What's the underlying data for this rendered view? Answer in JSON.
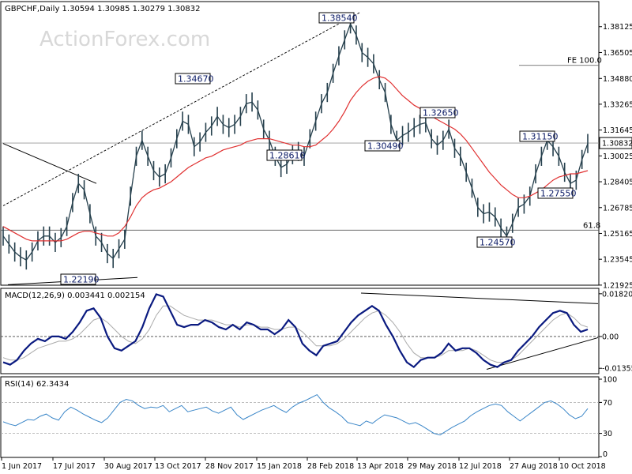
{
  "header": {
    "title": "GBPCHF,Daily  1.30594 1.30985 1.30279 1.30832",
    "watermark": "ActionForex.com"
  },
  "colors": {
    "price": "#26404d",
    "ma": "#e03030",
    "macd": "#0a1a80",
    "signal": "#aaaaaa",
    "rsi": "#3a86c8"
  },
  "chart_data": [
    {
      "type": "line",
      "panel": "price",
      "title": "GBPCHF,Daily  1.30594 1.30985 1.30279 1.30832",
      "ylim": [
        1.2192,
        1.394
      ],
      "y_ticks": [
        "1.38125",
        "1.36505",
        "1.34880",
        "1.33265",
        "1.31645",
        "1.30025",
        "1.28405",
        "1.26785",
        "1.25165",
        "1.23545",
        "1.21925"
      ],
      "current_price": "1.30832",
      "x_ticks": [
        "1 Jun 2017",
        "17 Jul 2017",
        "30 Aug 2017",
        "13 Oct 2017",
        "28 Nov 2017",
        "15 Jan 2018",
        "28 Feb 2018",
        "13 Apr 2018",
        "29 May 2018",
        "12 Jul 2018",
        "27 Aug 2018",
        "10 Oct 2018"
      ],
      "series": [
        {
          "values": [
            1.25,
            1.245,
            1.24,
            1.237,
            1.235,
            1.24,
            1.247,
            1.25,
            1.25,
            1.246,
            1.249,
            1.256,
            1.271,
            1.283,
            1.279,
            1.264,
            1.25,
            1.246,
            1.239,
            1.236,
            1.242,
            1.248,
            1.275,
            1.3,
            1.31,
            1.3,
            1.291,
            1.287,
            1.289,
            1.299,
            1.311,
            1.322,
            1.32,
            1.306,
            1.309,
            1.315,
            1.319,
            1.325,
            1.32,
            1.318,
            1.32,
            1.325,
            1.333,
            1.334,
            1.329,
            1.317,
            1.31,
            1.3,
            1.293,
            1.295,
            1.301,
            1.303,
            1.3,
            1.311,
            1.322,
            1.333,
            1.34,
            1.352,
            1.363,
            1.373,
            1.383,
            1.376,
            1.365,
            1.362,
            1.358,
            1.348,
            1.34,
            1.32,
            1.31,
            1.313,
            1.315,
            1.318,
            1.32,
            1.321,
            1.311,
            1.307,
            1.31,
            1.317,
            1.305,
            1.3,
            1.29,
            1.28,
            1.268,
            1.264,
            1.265,
            1.262,
            1.255,
            1.25,
            1.258,
            1.268,
            1.27,
            1.275,
            1.289,
            1.3,
            1.31,
            1.306,
            1.3,
            1.29,
            1.283,
            1.285,
            1.298,
            1.308
          ],
          "name": ""
        },
        {
          "values": [
            1.256,
            1.254,
            1.252,
            1.25,
            1.248,
            1.247,
            1.247,
            1.247,
            1.247,
            1.247,
            1.247,
            1.248,
            1.25,
            1.252,
            1.253,
            1.253,
            1.252,
            1.251,
            1.25,
            1.25,
            1.252,
            1.256,
            1.262,
            1.269,
            1.274,
            1.277,
            1.279,
            1.28,
            1.282,
            1.284,
            1.287,
            1.29,
            1.293,
            1.295,
            1.297,
            1.299,
            1.3,
            1.302,
            1.304,
            1.305,
            1.306,
            1.307,
            1.309,
            1.31,
            1.311,
            1.311,
            1.311,
            1.31,
            1.309,
            1.308,
            1.307,
            1.307,
            1.306,
            1.306,
            1.307,
            1.31,
            1.313,
            1.317,
            1.322,
            1.328,
            1.335,
            1.34,
            1.344,
            1.347,
            1.349,
            1.35,
            1.349,
            1.346,
            1.342,
            1.338,
            1.335,
            1.332,
            1.33,
            1.328,
            1.325,
            1.323,
            1.321,
            1.319,
            1.317,
            1.314,
            1.31,
            1.305,
            1.3,
            1.295,
            1.29,
            1.286,
            1.282,
            1.279,
            1.276,
            1.274,
            1.274,
            1.275,
            1.277,
            1.279,
            1.282,
            1.285,
            1.287,
            1.288,
            1.289,
            1.289,
            1.29,
            1.291
          ],
          "name": ""
        }
      ],
      "price_labels": [
        "1.38540",
        "1.34670",
        "1.32650",
        "1.31150",
        "1.30490",
        "1.28610",
        "1.27550",
        "1.24570",
        "1.22190"
      ],
      "annotations": [
        "FE 100.0",
        "61.8"
      ]
    },
    {
      "type": "line",
      "panel": "macd",
      "title": "MACD(12,26,9) 0.003441 0.002154",
      "ylim": [
        -0.0155,
        0.0195
      ],
      "y_ticks": [
        "0.018208",
        "0.00",
        "-0.013551"
      ],
      "series": [
        {
          "name": "",
          "values": [
            -0.011,
            -0.012,
            -0.01,
            -0.006,
            -0.003,
            -0.001,
            -0.002,
            0.0,
            0.0,
            -0.001,
            0.002,
            0.006,
            0.011,
            0.012,
            0.008,
            0.0,
            -0.005,
            -0.006,
            -0.004,
            -0.002,
            0.004,
            0.012,
            0.018,
            0.017,
            0.011,
            0.005,
            0.004,
            0.005,
            0.005,
            0.007,
            0.006,
            0.004,
            0.003,
            0.005,
            0.003,
            0.006,
            0.005,
            0.003,
            0.003,
            0.001,
            0.003,
            0.007,
            0.004,
            -0.003,
            -0.006,
            -0.008,
            -0.004,
            -0.003,
            -0.002,
            0.002,
            0.006,
            0.009,
            0.011,
            0.013,
            0.011,
            0.005,
            0.0,
            -0.006,
            -0.011,
            -0.013,
            -0.01,
            -0.009,
            -0.009,
            -0.007,
            -0.003,
            -0.006,
            -0.005,
            -0.005,
            -0.007,
            -0.01,
            -0.012,
            -0.013,
            -0.011,
            -0.01,
            -0.006,
            -0.003,
            0.0,
            0.004,
            0.007,
            0.01,
            0.011,
            0.01,
            0.005,
            0.002,
            0.003
          ]
        },
        {
          "name": "",
          "values": [
            -0.009,
            -0.01,
            -0.01,
            -0.009,
            -0.007,
            -0.005,
            -0.004,
            -0.003,
            -0.002,
            -0.002,
            -0.001,
            0.001,
            0.004,
            0.007,
            0.008,
            0.006,
            0.003,
            0.0,
            -0.002,
            -0.003,
            -0.001,
            0.003,
            0.009,
            0.013,
            0.013,
            0.011,
            0.009,
            0.008,
            0.007,
            0.007,
            0.007,
            0.006,
            0.005,
            0.005,
            0.004,
            0.005,
            0.005,
            0.004,
            0.004,
            0.003,
            0.003,
            0.004,
            0.004,
            0.002,
            -0.001,
            -0.004,
            -0.004,
            -0.004,
            -0.003,
            -0.001,
            0.002,
            0.005,
            0.008,
            0.01,
            0.011,
            0.009,
            0.006,
            0.002,
            -0.003,
            -0.007,
            -0.009,
            -0.009,
            -0.009,
            -0.008,
            -0.006,
            -0.006,
            -0.006,
            -0.005,
            -0.006,
            -0.008,
            -0.01,
            -0.011,
            -0.011,
            -0.01,
            -0.008,
            -0.005,
            -0.002,
            0.001,
            0.004,
            0.007,
            0.009,
            0.01,
            0.008,
            0.005,
            0.004
          ]
        }
      ]
    },
    {
      "type": "line",
      "panel": "rsi",
      "title": "RSI(14) 62.3434",
      "ylim": [
        0,
        100
      ],
      "y_ticks": [
        "100",
        "70",
        "30",
        "0"
      ],
      "series": [
        {
          "name": "",
          "values": [
            45,
            42,
            40,
            44,
            48,
            47,
            52,
            55,
            50,
            47,
            58,
            64,
            60,
            55,
            51,
            47,
            44,
            50,
            60,
            70,
            74,
            72,
            66,
            62,
            64,
            63,
            66,
            58,
            62,
            66,
            58,
            60,
            62,
            64,
            59,
            56,
            60,
            64,
            54,
            48,
            52,
            56,
            60,
            63,
            66,
            61,
            57,
            64,
            69,
            72,
            76,
            80,
            70,
            63,
            58,
            52,
            44,
            42,
            40,
            46,
            43,
            49,
            54,
            52,
            50,
            46,
            42,
            44,
            40,
            35,
            30,
            28,
            33,
            38,
            42,
            46,
            53,
            58,
            62,
            66,
            68,
            66,
            58,
            52,
            46,
            52,
            58,
            64,
            70,
            72,
            68,
            62,
            54,
            49,
            52,
            62
          ]
        }
      ]
    }
  ]
}
